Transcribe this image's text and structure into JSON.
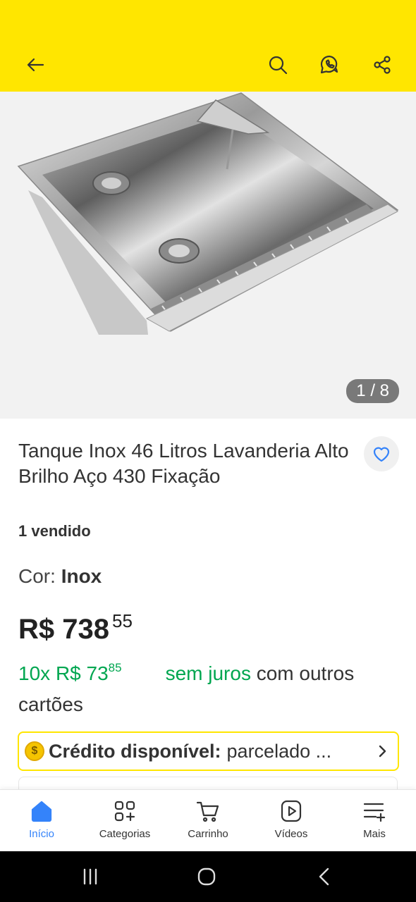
{
  "header": {
    "icons": [
      "back-arrow-icon",
      "search-icon",
      "whatsapp-icon",
      "share-icon"
    ],
    "background": "#ffe600"
  },
  "gallery": {
    "counter": "1 / 8",
    "image": "stainless-steel-laundry-sink"
  },
  "product": {
    "title": "Tanque Inox 46 Litros Lavanderia Alto Brilho Aço 430 Fixação",
    "sold": "1 vendido",
    "color_label": "Cor: ",
    "color_value": "Inox",
    "price_main": "R$ 738",
    "price_cents": "55",
    "installments_count": "10x",
    "installment_value": "R$ 73",
    "installment_cents": "85",
    "no_interest": "sem juros",
    "installments_suffix": " com outros cartões"
  },
  "credit": {
    "coin": "$",
    "label": "Crédito disponível:",
    "text": "parcelado ..."
  },
  "tabs": [
    {
      "label": "Início",
      "icon": "home-icon",
      "active": true
    },
    {
      "label": "Categorias",
      "icon": "categories-icon"
    },
    {
      "label": "Carrinho",
      "icon": "cart-icon"
    },
    {
      "label": "Vídeos",
      "icon": "video-icon"
    },
    {
      "label": "Mais",
      "icon": "more-icon"
    }
  ],
  "colors": {
    "accent_blue": "#3483fa",
    "green": "#00a650",
    "yellow": "#ffe600"
  }
}
